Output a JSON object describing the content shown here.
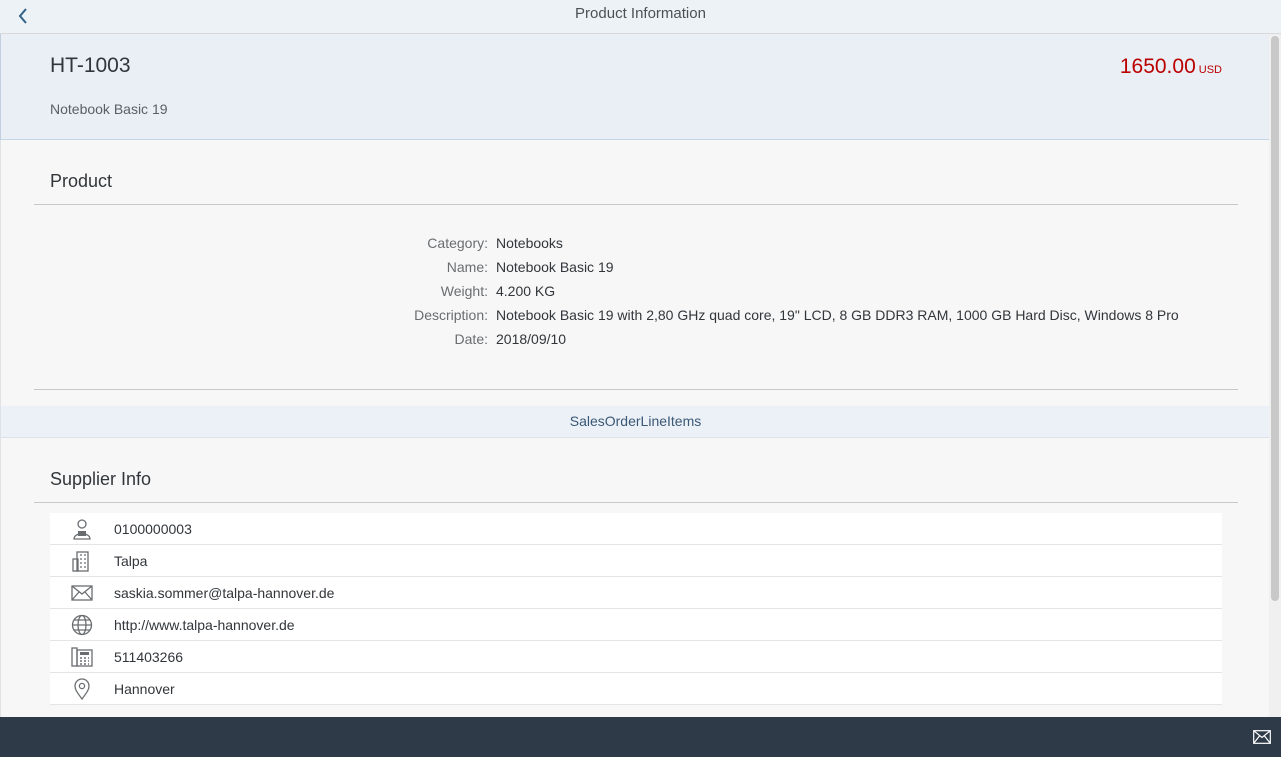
{
  "header": {
    "title": "Product Information"
  },
  "object": {
    "id": "HT-1003",
    "subtitle": "Notebook Basic 19",
    "price": "1650.00",
    "currency": "USD"
  },
  "product_section": {
    "title": "Product",
    "fields": [
      {
        "label": "Category:",
        "value": "Notebooks"
      },
      {
        "label": "Name:",
        "value": "Notebook Basic 19"
      },
      {
        "label": "Weight:",
        "value": "4.200 KG"
      },
      {
        "label": "Description:",
        "value": "Notebook Basic 19 with 2,80 GHz quad core, 19\" LCD, 8 GB DDR3 RAM, 1000 GB Hard Disc, Windows 8 Pro"
      },
      {
        "label": "Date:",
        "value": "2018/09/10"
      }
    ]
  },
  "link_bar": {
    "label": "SalesOrderLineItems"
  },
  "supplier": {
    "title": "Supplier Info",
    "items": [
      {
        "icon": "person-icon",
        "value": "0100000003"
      },
      {
        "icon": "building-icon",
        "value": "Talpa"
      },
      {
        "icon": "email-icon",
        "value": "saskia.sommer@talpa-hannover.de"
      },
      {
        "icon": "globe-icon",
        "value": "http://www.talpa-hannover.de"
      },
      {
        "icon": "phone-icon",
        "value": "511403266"
      },
      {
        "icon": "location-icon",
        "value": "Hannover"
      }
    ]
  },
  "colors": {
    "price": "#bb0000",
    "footer": "#2e3a48",
    "header": "#edf2f7"
  }
}
